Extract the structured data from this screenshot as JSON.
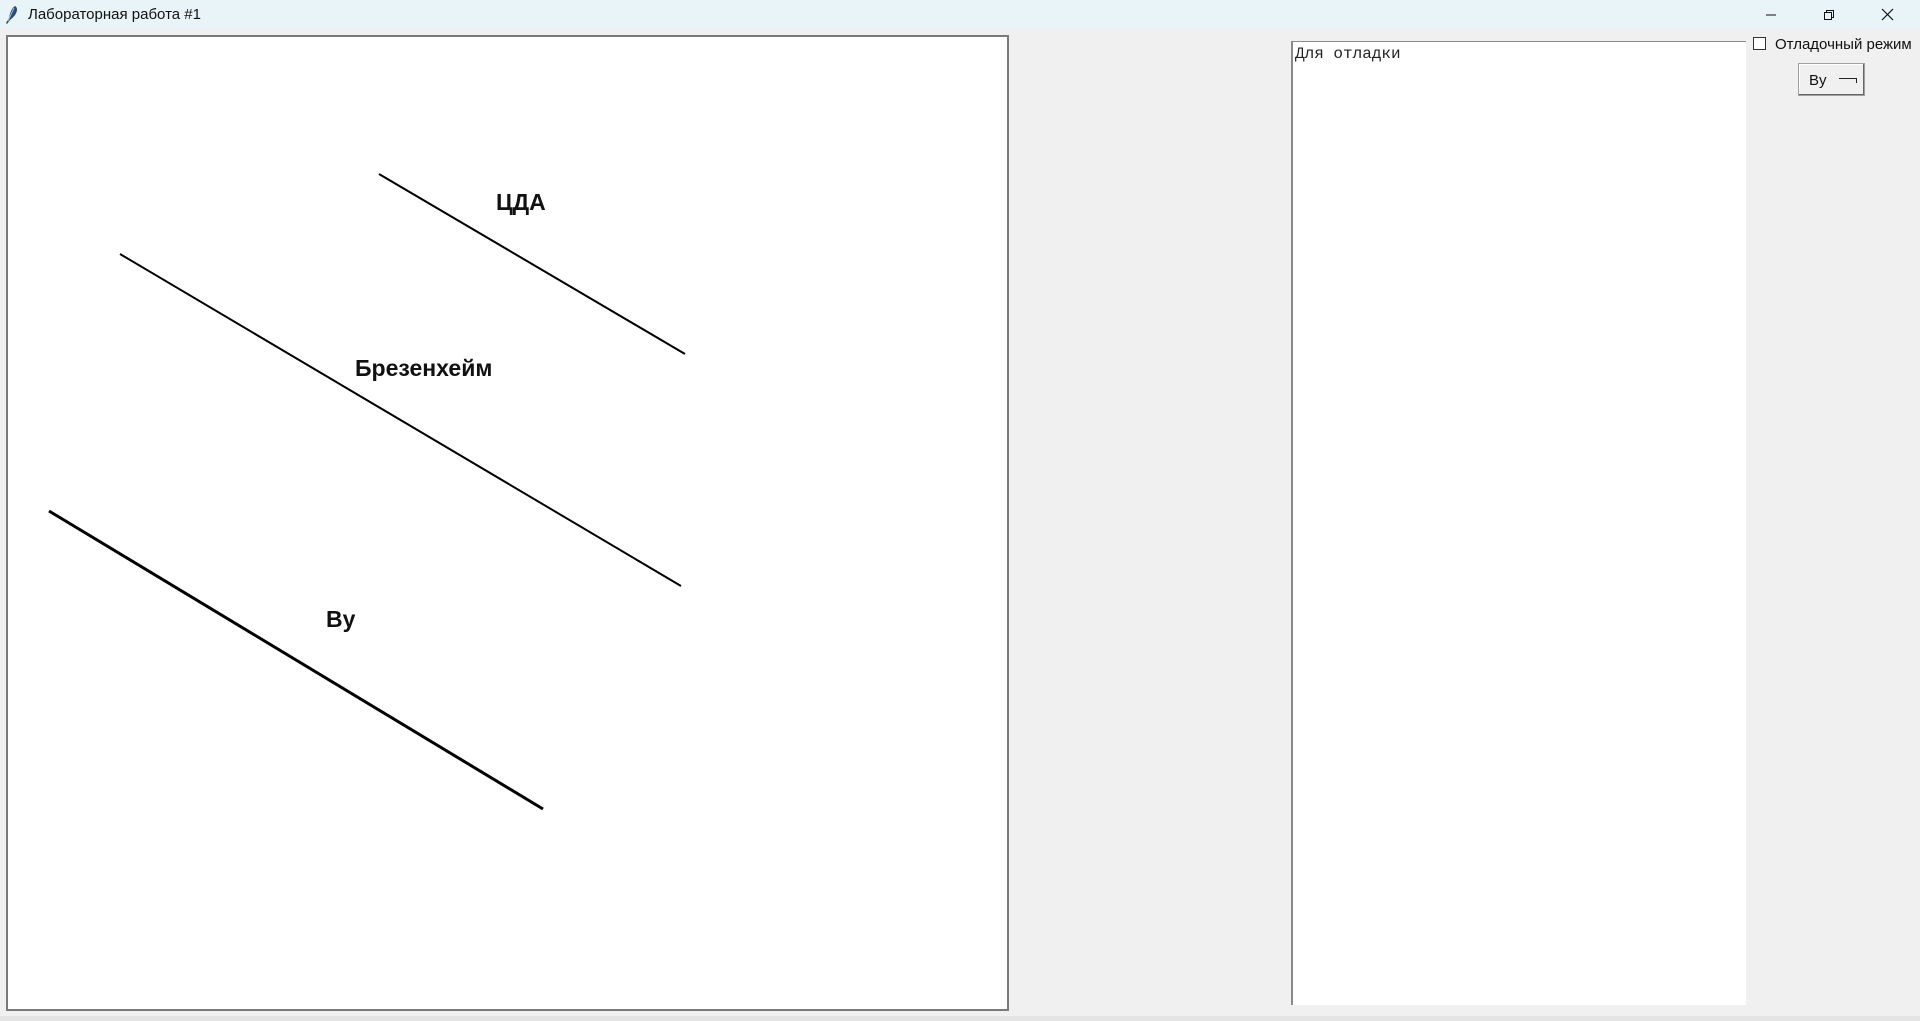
{
  "window": {
    "title": "Лабораторная работа #1",
    "controls": [
      "minimize-icon",
      "restore-icon",
      "close-icon"
    ]
  },
  "canvas": {
    "lines": [
      {
        "label": "ЦДА",
        "algorithm": "dda"
      },
      {
        "label": "Брезенхейм",
        "algorithm": "bresenham"
      },
      {
        "label": "By",
        "algorithm": "wu"
      }
    ]
  },
  "debug": {
    "text": "Для отладки"
  },
  "controls": {
    "debug_mode_label": "Отладочный режим",
    "debug_mode_checked": false,
    "algorithm_selected": "By"
  },
  "colors": {
    "titlebar": "#e8f4f8",
    "background": "#f0f0f0",
    "canvas": "#ffffff",
    "line": "#000000"
  }
}
